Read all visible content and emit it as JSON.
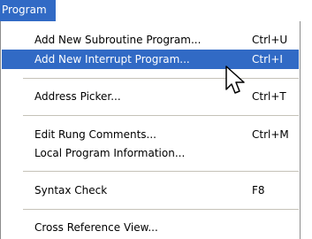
{
  "menubar": {
    "title": "Program"
  },
  "menu": {
    "items": [
      {
        "label": "Add New Subroutine Program...",
        "shortcut": "Ctrl+U"
      },
      {
        "label": "Add New Interrupt Program...",
        "shortcut": "Ctrl+I",
        "highlighted": true
      },
      {
        "label": "Address Picker...",
        "shortcut": "Ctrl+T"
      },
      {
        "label": "Edit Rung Comments...",
        "shortcut": "Ctrl+M"
      },
      {
        "label": "Local Program Information...",
        "shortcut": ""
      },
      {
        "label": "Syntax Check",
        "shortcut": "F8"
      },
      {
        "label": "Cross Reference View...",
        "shortcut": ""
      }
    ]
  },
  "colors": {
    "highlight": "#316ac5",
    "separator": "#c5c2b8"
  },
  "cursor": {
    "icon": "arrow-pointer-icon"
  }
}
